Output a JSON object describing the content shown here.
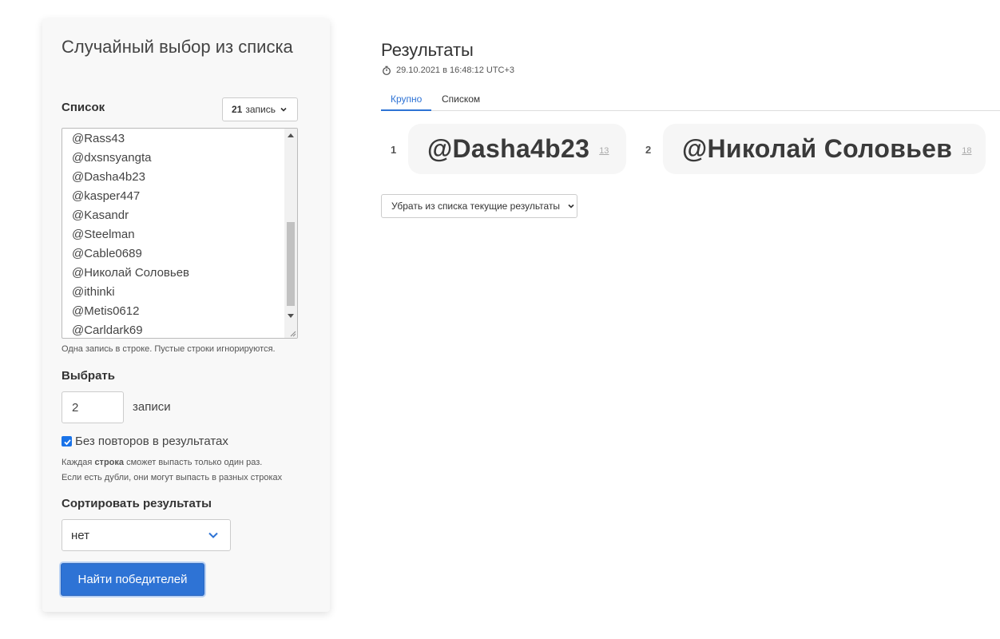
{
  "panel": {
    "title": "Случайный выбор из списка",
    "list_label": "Список",
    "count_button": {
      "count": "21",
      "unit": "запись"
    },
    "list_items": [
      "@Rass43",
      "@dxsnsyangta",
      "@Dasha4b23",
      "@kasper447",
      "@Kasandr",
      "@Steelman",
      "@Cable0689",
      "@Николай Соловьев",
      "@ithinki",
      "@Metis0612",
      "@Carldark69"
    ],
    "list_hint": "Одна запись в строке. Пустые строки игнорируются.",
    "pick_label": "Выбрать",
    "pick_value": "2",
    "pick_unit": "записи",
    "no_repeat_label": "Без повторов в результатах",
    "no_repeat_checked": true,
    "no_repeat_hint_1_a": "Каждая ",
    "no_repeat_hint_1_b": "строка",
    "no_repeat_hint_1_c": " сможет выпасть только один раз.",
    "no_repeat_hint_2": "Если есть дубли, они могут выпасть в разных строках",
    "sort_label": "Сортировать результаты",
    "sort_value": "нет",
    "submit_label": "Найти победителей"
  },
  "results": {
    "title": "Результаты",
    "timestamp": "29.10.2021 в 16:48:12 UTC+3",
    "tabs": [
      {
        "label": "Крупно",
        "active": true
      },
      {
        "label": "Списком",
        "active": false
      }
    ],
    "winners": [
      {
        "index": "1",
        "name": "@Dasha4b23",
        "line": "13"
      },
      {
        "index": "2",
        "name": "@Николай Соловьев",
        "line": "18"
      }
    ],
    "remove_button_label": "Убрать из списка текущие результаты"
  },
  "colors": {
    "accent": "#2e73d5",
    "panel_bg": "#f8f8f8",
    "card_bg": "#f6f6f6"
  }
}
